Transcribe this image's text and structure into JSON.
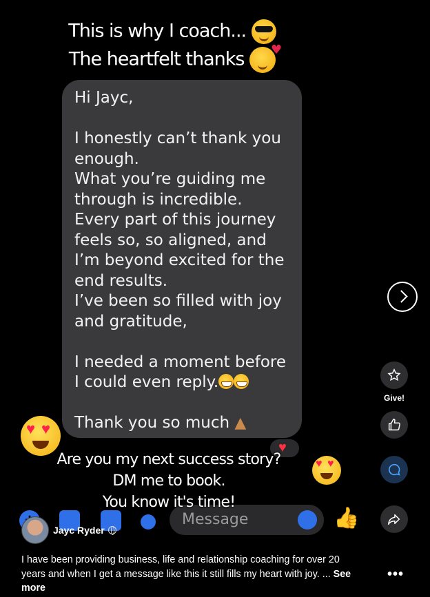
{
  "story": {
    "caption_line1": "This is why I coach...",
    "caption_line2": "The heartfelt thanks",
    "message": "Hi Jayc,\n\nI honestly can’t thank you enough.\nWhat you’re guiding me through is incredible.\nEvery part of this journey feels so, so aligned, and I’m beyond excited for the end results.\nI’ve been so filled with joy and gratitude,\n\nI needed a moment before I could even reply.",
    "message_closing": "Thank you so much",
    "cta_line1": "Are you my next success story?",
    "cta_line2": "DM me to book.",
    "cta_line3": "You know it's time!",
    "composer_placeholder": "Message"
  },
  "sidebar": {
    "give_label": "Give!"
  },
  "post": {
    "author": "Jayc Ryder",
    "description": "I have been providing business, life and relationship coaching for over 20 years and when I get a message like this it still fills my heart with joy. ...",
    "see_more": "See more",
    "more_options": "•••"
  },
  "colors": {
    "bubble": "#3a3a3c",
    "accent": "#2f6fe8",
    "heart": "#ff3040"
  },
  "icons": [
    "sunglasses-emoji-icon",
    "smiling-hearts-emoji-icon",
    "grin-emoji-icon",
    "pray-emoji-icon",
    "heart-eyes-emoji-icon",
    "heart-reaction-icon",
    "chevron-right-icon",
    "give-star-icon",
    "like-icon",
    "comment-icon",
    "share-icon",
    "globe-icon"
  ]
}
